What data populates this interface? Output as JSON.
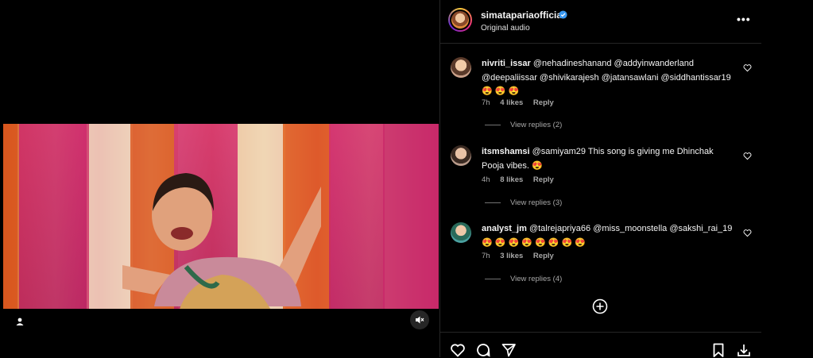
{
  "post": {
    "username": "simataparia official",
    "username_display": "simatapariaofficial",
    "subtitle": "Original audio",
    "more_label": "•••"
  },
  "comments": [
    {
      "user": "nivriti_issar",
      "text": "@nehadineshanand @addyinwanderland @deepaliissar @shivikarajesh @jatansawlani @siddhantissar19 😍 😍 😍",
      "time": "7h",
      "likes": "4 likes",
      "reply": "Reply",
      "view_replies": "View replies (2)"
    },
    {
      "user": "itsmshamsi",
      "text": "@samiyam29 This song is giving me Dhinchak Pooja vibes. 😍",
      "time": "4h",
      "likes": "8 likes",
      "reply": "Reply",
      "view_replies": "View replies (3)"
    },
    {
      "user": "analyst_jm",
      "text": "@talrejapriya66 @miss_moonstella @sakshi_rai_19 😍 😍 😍 😍 😍 😍 😍 😍",
      "time": "7h",
      "likes": "3 likes",
      "reply": "Reply",
      "view_replies": "View replies (4)"
    }
  ],
  "icons": {
    "user": "user-icon",
    "mute": "speaker-muted-icon",
    "verified": "verified-badge-icon",
    "like": "heart-icon",
    "comment": "comment-icon",
    "share": "share-icon",
    "save": "bookmark-icon",
    "download": "download-icon",
    "add": "plus-circle-icon"
  },
  "colors": {
    "background": "#000000",
    "text": "#f5f5f5",
    "muted": "#a8a8a8",
    "verified": "#3897f0"
  }
}
